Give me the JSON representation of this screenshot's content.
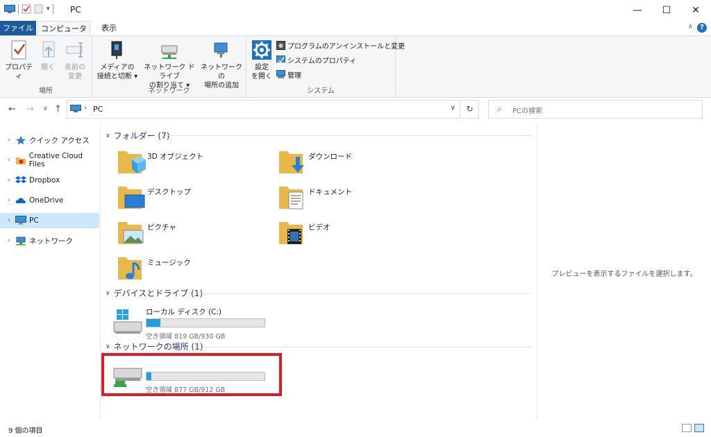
{
  "window": {
    "title": "PC"
  },
  "tabs": {
    "file": "ファイル",
    "computer": "コンピューター",
    "view": "表示",
    "help": "?"
  },
  "ribbon": {
    "location": {
      "label": "場所",
      "properties": "プロパティ",
      "open": "開く",
      "rename_1": "名前の",
      "rename_2": "変更"
    },
    "network": {
      "label": "ネットワーク",
      "media_1": "メディアの",
      "media_2": "接続と切断 ▾",
      "map_1": "ネットワーク ドライブ",
      "map_2": "の割り当て ▾",
      "add_1": "ネットワークの",
      "add_2": "場所の追加"
    },
    "system": {
      "label": "システム",
      "settings_1": "設定",
      "settings_2": "を開く",
      "uninstall": "プログラムのアンインストールと変更",
      "sysprops": "システムのプロパティ",
      "manage": "管理"
    }
  },
  "address": {
    "path": "PC"
  },
  "search": {
    "placeholder": "PCの検索"
  },
  "nav": {
    "quick_access": "クイック アクセス",
    "creative_cloud": "Creative Cloud Files",
    "dropbox": "Dropbox",
    "onedrive": "OneDrive",
    "pc": "PC",
    "network": "ネットワーク"
  },
  "sections": {
    "folders": "フォルダー (7)",
    "devices": "デバイスとドライブ (1)",
    "network_locations": "ネットワークの場所 (1)"
  },
  "folders": {
    "objects3d": "3D オブジェクト",
    "downloads": "ダウンロード",
    "desktop": "デスクトップ",
    "documents": "ドキュメント",
    "pictures": "ピクチャ",
    "videos": "ビデオ",
    "music": "ミュージック"
  },
  "drives": {
    "local": {
      "name": "ローカル ディスク (C:)",
      "free": "空き領域 819 GB/930 GB",
      "used_fraction": 0.12
    },
    "net": {
      "name": "",
      "free": "空き領域 877 GB/912 GB",
      "used_fraction": 0.04
    }
  },
  "preview": {
    "message": "プレビューを表示するファイルを選択します。"
  },
  "status": {
    "count": "9 個の項目"
  },
  "colors": {
    "accent": "#1e5b9e",
    "highlight": "#e01b24",
    "selection": "#cce8ff",
    "bar": "#26a0da"
  }
}
